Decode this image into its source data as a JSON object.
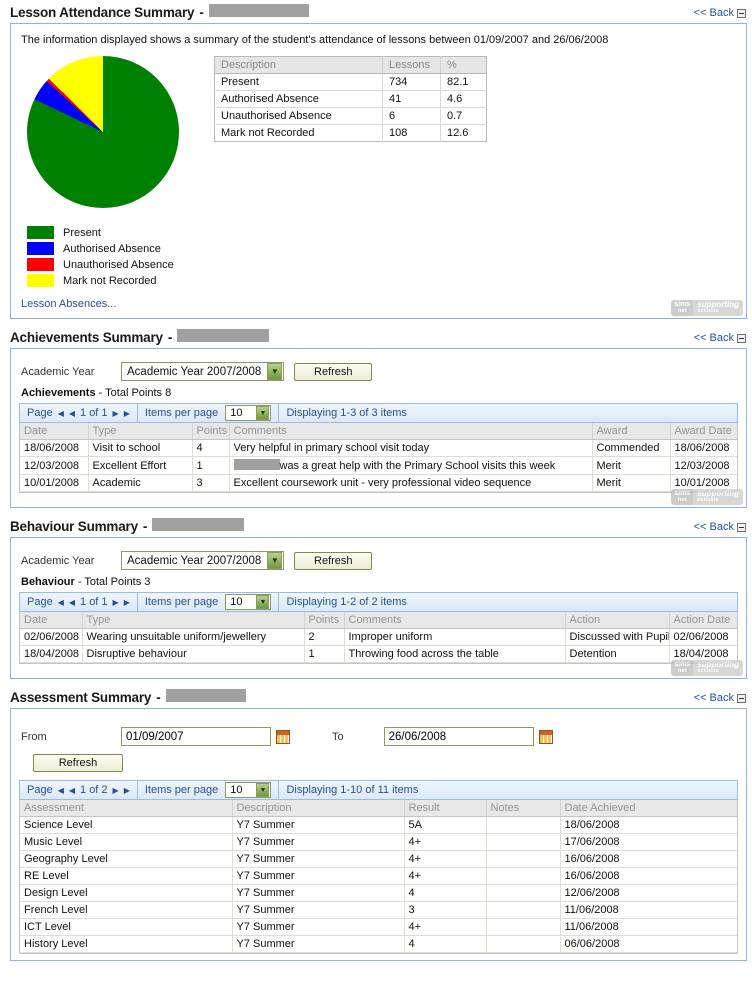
{
  "common": {
    "back_label": "<< Back",
    "collapse_icon": "collapse-box",
    "refresh_label": "Refresh",
    "academic_year_label": "Academic Year",
    "academic_year_value": "Academic Year 2007/2008",
    "items_per_page_label": "Items per page",
    "items_per_page_value": "10",
    "page_label": "Page",
    "logo_primary": "sims",
    "logo_primary_sub": "net",
    "logo_secondary": "supporting",
    "logo_secondary_sub": "schools"
  },
  "attendance": {
    "title": "Lesson Attendance Summary",
    "student_redacted": true,
    "intro": "The information displayed shows a summary of the student's attendance of lessons between 01/09/2007 and 26/06/2008",
    "table_headers": [
      "Description",
      "Lessons",
      "%"
    ],
    "rows": [
      {
        "description": "Present",
        "lessons": "734",
        "percent": "82.1"
      },
      {
        "description": "Authorised Absence",
        "lessons": "41",
        "percent": "4.6"
      },
      {
        "description": "Unauthorised Absence",
        "lessons": "6",
        "percent": "0.7"
      },
      {
        "description": "Mark not Recorded",
        "lessons": "108",
        "percent": "12.6"
      }
    ],
    "absences_link": "Lesson Absences..."
  },
  "chart_data": {
    "type": "pie",
    "title": "Lesson Attendance Summary",
    "categories": [
      "Present",
      "Authorised Absence",
      "Unauthorised Absence",
      "Mark not Recorded"
    ],
    "values": [
      82.1,
      4.6,
      0.7,
      12.6
    ],
    "counts": [
      734,
      41,
      6,
      108
    ],
    "colors": [
      "#008000",
      "#0000ff",
      "#ff0000",
      "#ffff00"
    ],
    "legend_position": "below",
    "start_angle_deg": 0,
    "direction": "clockwise",
    "units": "percent"
  },
  "achievements": {
    "title": "Achievements Summary",
    "sub_title_bold": "Achievements",
    "sub_title_rest": " - Total Points 8",
    "pager": {
      "page_of": "1 of 1",
      "displaying": "Displaying 1-3 of 3 items"
    },
    "headers": [
      "Date",
      "Type",
      "Points",
      "Comments",
      "Award",
      "Award Date"
    ],
    "rows": [
      {
        "date": "18/06/2008",
        "type": "Visit to school",
        "points": "4",
        "comments": "Very helpful in primary school visit today",
        "comments_redacted": false,
        "comments_suffix": "",
        "award": "Commended",
        "award_date": "18/06/2008"
      },
      {
        "date": "12/03/2008",
        "type": "Excellent Effort",
        "points": "1",
        "comments": "",
        "comments_redacted": true,
        "comments_suffix": "was a great help with the Primary School visits this week",
        "award": "Merit",
        "award_date": "12/03/2008"
      },
      {
        "date": "10/01/2008",
        "type": "Academic",
        "points": "3",
        "comments": "Excellent coursework unit - very professional video sequence",
        "comments_redacted": false,
        "comments_suffix": "",
        "award": "Merit",
        "award_date": "10/01/2008"
      }
    ]
  },
  "behaviour": {
    "title": "Behaviour Summary",
    "sub_title_bold": "Behaviour",
    "sub_title_rest": " - Total Points 3",
    "pager": {
      "page_of": "1 of 1",
      "displaying": "Displaying 1-2 of 2 items"
    },
    "headers": [
      "Date",
      "Type",
      "Points",
      "Comments",
      "Action",
      "Action Date"
    ],
    "rows": [
      {
        "date": "02/06/2008",
        "type": "Wearing unsuitable uniform/jewellery",
        "points": "2",
        "comments": "Improper uniform",
        "action": "Discussed with Pupil",
        "action_date": "02/06/2008"
      },
      {
        "date": "18/04/2008",
        "type": "Disruptive behaviour",
        "points": "1",
        "comments": "Throwing food across the table",
        "action": "Detention",
        "action_date": "18/04/2008"
      }
    ]
  },
  "assessment": {
    "title": "Assessment Summary",
    "from_label": "From",
    "from_value": "01/09/2007",
    "to_label": "To",
    "to_value": "26/06/2008",
    "calendar_icon": "calendar-icon",
    "pager": {
      "page_of": "1 of 2",
      "displaying": "Displaying 1-10 of 11 items"
    },
    "headers": [
      "Assessment",
      "Description",
      "Result",
      "Notes",
      "Date Achieved"
    ],
    "rows": [
      {
        "assessment": "Science Level",
        "description": "Y7 Summer",
        "result": "5A",
        "notes": "",
        "date": "18/06/2008"
      },
      {
        "assessment": "Music Level",
        "description": "Y7 Summer",
        "result": "4+",
        "notes": "",
        "date": "17/06/2008"
      },
      {
        "assessment": "Geography Level",
        "description": "Y7 Summer",
        "result": "4+",
        "notes": "",
        "date": "16/06/2008"
      },
      {
        "assessment": "RE Level",
        "description": "Y7 Summer",
        "result": "4+",
        "notes": "",
        "date": "16/06/2008"
      },
      {
        "assessment": "Design Level",
        "description": "Y7 Summer",
        "result": "4",
        "notes": "",
        "date": "12/06/2008"
      },
      {
        "assessment": "French Level",
        "description": "Y7 Summer",
        "result": "3",
        "notes": "",
        "date": "11/06/2008"
      },
      {
        "assessment": "ICT Level",
        "description": "Y7 Summer",
        "result": "4+",
        "notes": "",
        "date": "11/06/2008"
      },
      {
        "assessment": "History Level",
        "description": "Y7 Summer",
        "result": "4",
        "notes": "",
        "date": "06/06/2008"
      }
    ]
  }
}
